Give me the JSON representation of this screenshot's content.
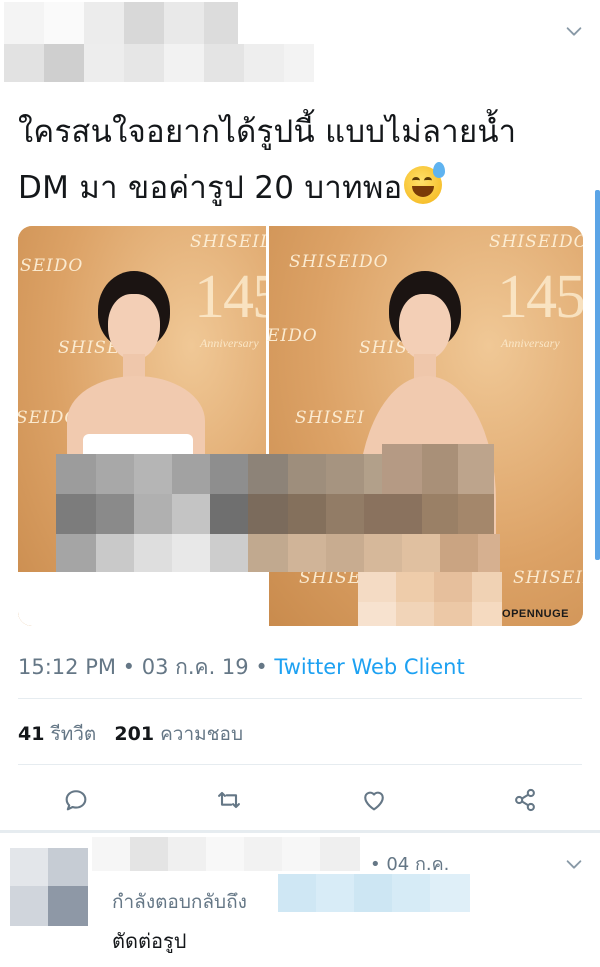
{
  "tweet": {
    "text_line1": "ใครสนใจอยากได้รูปนี้ แบบไม่ลายน้ำ",
    "text_line2": "DM มา ขอค่ารูป 20 บาทพอ",
    "emoji": "sweat-smile-emoji",
    "meta": {
      "time": "15:12 PM",
      "sep": " • ",
      "date": "03 ก.ค. 19",
      "client": "Twitter Web Client"
    },
    "stats": {
      "retweets": "41",
      "retweets_label": "รีทวีต",
      "likes": "201",
      "likes_label": "ความชอบ"
    },
    "media": {
      "brand": "SHISEIDO",
      "brand_cut": "SHISEID",
      "brand_left": "SEIDO",
      "brand_ido": "EIDO",
      "brand_shis": "SHISEI",
      "brand_ido2": "IDO",
      "big": "145",
      "anniversary": "Anniversary",
      "watermark": "OPENNUGE"
    },
    "actions": [
      "reply-icon",
      "retweet-icon",
      "like-icon",
      "share-icon"
    ]
  },
  "reply": {
    "date": "• 04 ก.ค.",
    "replying_to": "กำลังตอบกลับถึง",
    "text": "ตัดต่อรูป"
  },
  "colors": {
    "accent": "#1da1f2",
    "muted": "#657786",
    "text": "#14171a"
  }
}
